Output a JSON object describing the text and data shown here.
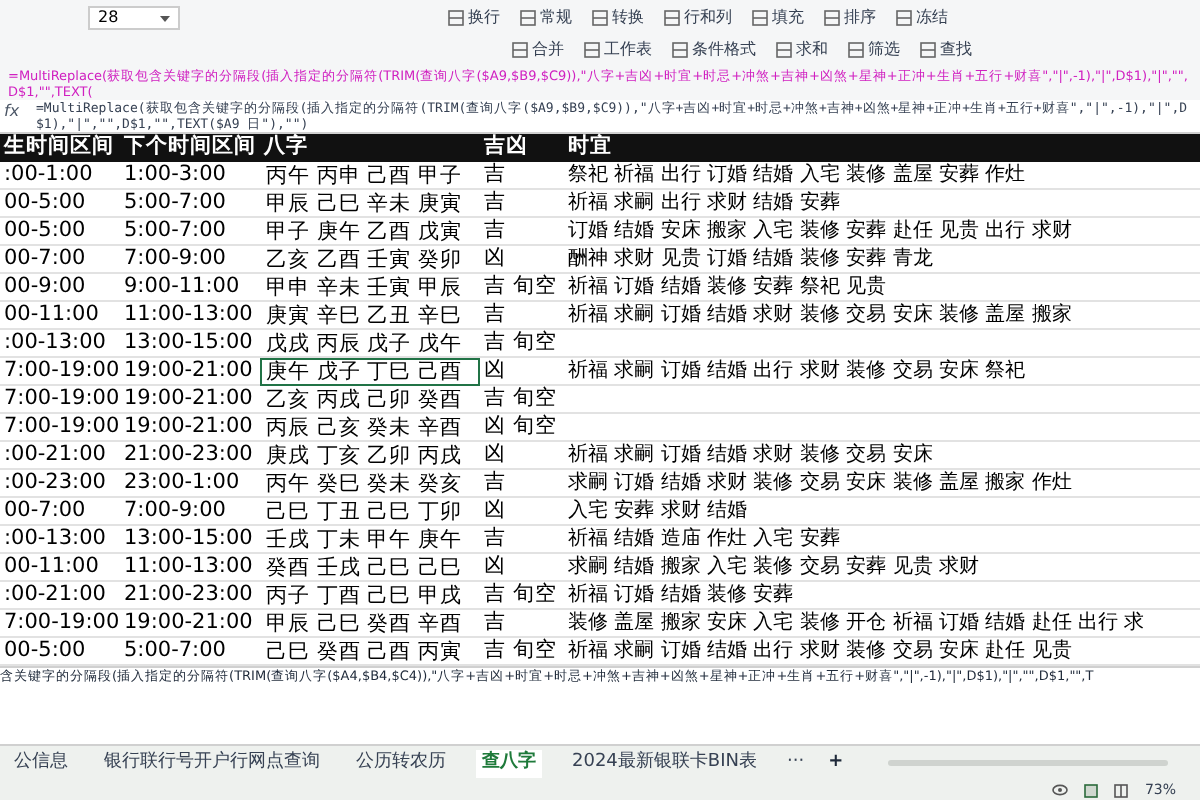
{
  "toolbar": {
    "font_size": "28",
    "top_row": [
      "换行",
      "常规",
      "转换",
      "行和列",
      "填充",
      "排序",
      "冻结"
    ],
    "bottom_row": [
      "合并",
      "工作表",
      "条件格式",
      "求和",
      "筛选",
      "查找"
    ]
  },
  "formula_overlay": "=MultiReplace(获取包含关键字的分隔段(插入指定的分隔符(TRIM(查询八字($A9,$B9,$C9)),\"八字+吉凶+时宜+时忌+冲煞+吉神+凶煞+星神+正冲+生肖+五行+财喜\",\"|\",-1),\"|\",D$1),\"|\",\"\",D$1,\"\",TEXT(",
  "formula_bar": {
    "fx_label": "fx",
    "value": "=MultiReplace(获取包含关键字的分隔段(插入指定的分隔符(TRIM(查询八字($A9,$B9,$C9)),\"八字+吉凶+时宜+时忌+冲煞+吉神+凶煞+星神+正冲+生肖+五行+财喜\",\"|\",-1),\"|\",D$1),\"|\",\"\",D$1,\"\",TEXT($A9 日\"),\"\")"
  },
  "sheet": {
    "columns": [
      "生时间区间",
      "下个时间区间",
      "八字",
      "吉凶",
      "时宜"
    ],
    "rows": [
      {
        "cells": [
          ":00-1:00",
          "1:00-3:00",
          "丙午 丙申 己酉 甲子",
          "吉",
          "祭祀 祈福 出行 订婚 结婚 入宅 装修 盖屋 安葬 作灶"
        ],
        "selected": false
      },
      {
        "cells": [
          "00-5:00",
          "5:00-7:00",
          "甲辰 己巳 辛未 庚寅",
          "吉",
          "祈福 求嗣 出行 求财 结婚 安葬"
        ],
        "selected": false
      },
      {
        "cells": [
          "00-5:00",
          "5:00-7:00",
          "甲子 庚午 乙酉 戊寅",
          "吉",
          "订婚 结婚 安床 搬家 入宅 装修 安葬 赴任 见贵 出行 求财"
        ],
        "selected": false
      },
      {
        "cells": [
          "00-7:00",
          "7:00-9:00",
          "乙亥 乙酉 壬寅 癸卯",
          "凶",
          "酬神 求财 见贵 订婚 结婚 装修 安葬 青龙"
        ],
        "selected": false
      },
      {
        "cells": [
          "00-9:00",
          "9:00-11:00",
          "甲申 辛未 壬寅 甲辰",
          "吉 旬空",
          "祈福 订婚 结婚 装修 安葬 祭祀 见贵"
        ],
        "selected": false
      },
      {
        "cells": [
          "00-11:00",
          "11:00-13:00",
          "庚寅 辛巳 乙丑 辛巳",
          "吉",
          "祈福 求嗣 订婚 结婚 求财 装修 交易 安床 装修 盖屋 搬家"
        ],
        "selected": false
      },
      {
        "cells": [
          ":00-13:00",
          "13:00-15:00",
          "戊戌 丙辰 戊子 戊午",
          "吉 旬空",
          ""
        ],
        "selected": false
      },
      {
        "cells": [
          "7:00-19:00",
          "19:00-21:00",
          "庚午 戊子 丁巳 己酉",
          "凶",
          "祈福 求嗣 订婚 结婚 出行 求财 装修 交易 安床 祭祀"
        ],
        "selected": true
      },
      {
        "cells": [
          "7:00-19:00",
          "19:00-21:00",
          "乙亥 丙戌 己卯 癸酉",
          "吉 旬空",
          ""
        ],
        "selected": false
      },
      {
        "cells": [
          "7:00-19:00",
          "19:00-21:00",
          "丙辰 己亥 癸未 辛酉",
          "凶 旬空",
          ""
        ],
        "selected": false
      },
      {
        "cells": [
          ":00-21:00",
          "21:00-23:00",
          "庚戌 丁亥 乙卯 丙戌",
          "凶",
          "祈福 求嗣 订婚 结婚 求财 装修 交易 安床"
        ],
        "selected": false
      },
      {
        "cells": [
          ":00-23:00",
          "23:00-1:00",
          "丙午 癸巳 癸未 癸亥",
          "吉",
          "求嗣 订婚 结婚 求财 装修 交易 安床 装修 盖屋 搬家 作灶"
        ],
        "selected": false
      },
      {
        "cells": [
          "00-7:00",
          "7:00-9:00",
          "己巳 丁丑 己巳 丁卯",
          "凶",
          "入宅 安葬 求财 结婚"
        ],
        "selected": false
      },
      {
        "cells": [
          ":00-13:00",
          "13:00-15:00",
          "壬戌 丁未 甲午 庚午",
          "吉",
          "祈福 结婚 造庙 作灶 入宅 安葬"
        ],
        "selected": false
      },
      {
        "cells": [
          "00-11:00",
          "11:00-13:00",
          "癸酉 壬戌 己巳 己巳",
          "凶",
          "求嗣 结婚 搬家 入宅 装修 交易 安葬 见贵 求财"
        ],
        "selected": false
      },
      {
        "cells": [
          ":00-21:00",
          "21:00-23:00",
          "丙子 丁酉 己巳 甲戌",
          "吉 旬空",
          "祈福 订婚 结婚 装修 安葬"
        ],
        "selected": false
      },
      {
        "cells": [
          "7:00-19:00",
          "19:00-21:00",
          "甲辰 己巳 癸酉 辛酉",
          "吉",
          "装修 盖屋 搬家 安床 入宅 装修 开仓 祈福 订婚 结婚 赴任 出行 求"
        ],
        "selected": false
      },
      {
        "cells": [
          "00-5:00",
          "5:00-7:00",
          "己巳 癸酉 己酉 丙寅",
          "吉 旬空",
          "祈福 求嗣 订婚 结婚 出行 求财 装修 交易 安床 赴任 见贵"
        ],
        "selected": false
      }
    ]
  },
  "formula_strip": "含关键字的分隔段(插入指定的分隔符(TRIM(查询八字($A4,$B4,$C4)),\"八字+吉凶+时宜+时忌+冲煞+吉神+凶煞+星神+正冲+生肖+五行+财喜\",\"|\",-1),\"|\",D$1),\"|\",\"\",D$1,\"\",T",
  "sheet_tabs": {
    "tabs": [
      {
        "label": "公信息",
        "selected": false
      },
      {
        "label": "银行联行号开户行网点查询",
        "selected": false
      },
      {
        "label": "公历转农历",
        "selected": false
      },
      {
        "label": "查八字",
        "selected": true
      },
      {
        "label": "2024最新银联卡BIN表",
        "selected": false
      }
    ],
    "more": "···",
    "add": "+"
  },
  "status_bar": {
    "zoom": "73%"
  }
}
